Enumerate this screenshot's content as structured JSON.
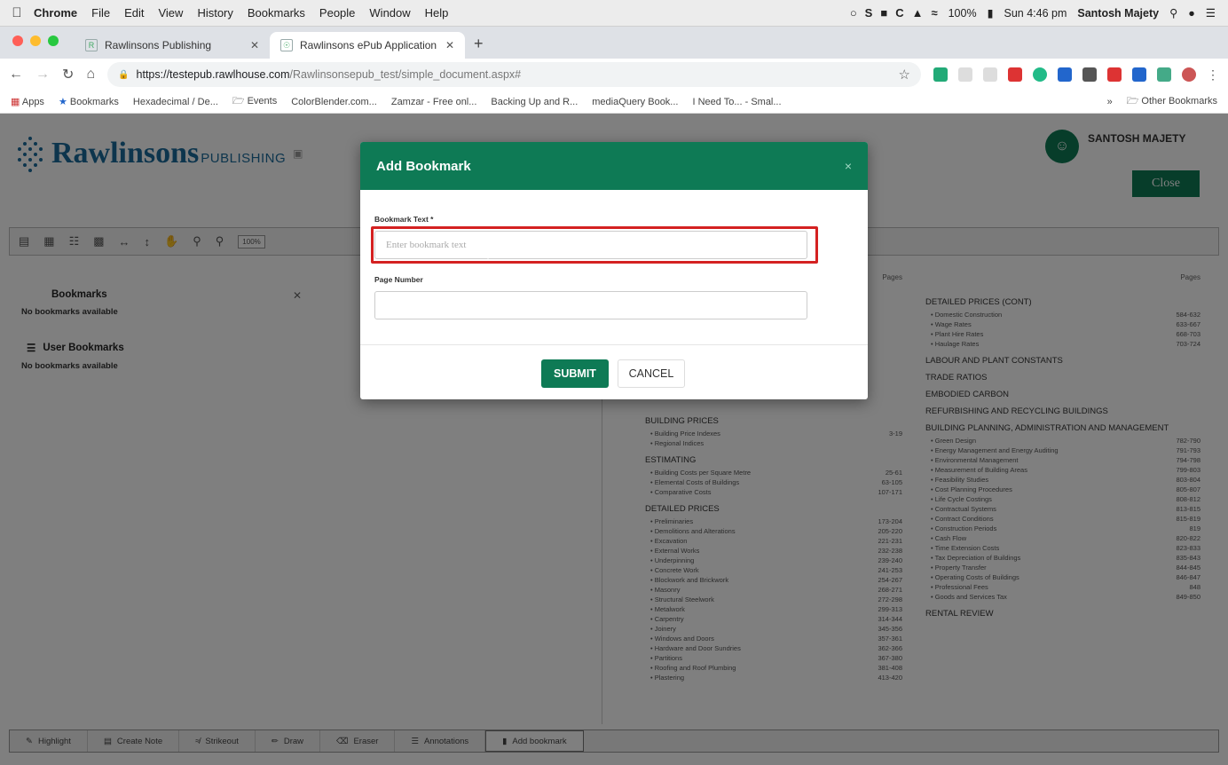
{
  "menubar": {
    "app": "Chrome",
    "items": [
      "File",
      "Edit",
      "View",
      "History",
      "Bookmarks",
      "People",
      "Window",
      "Help"
    ],
    "battery": "100%",
    "clock": "Sun 4:46 pm",
    "user": "Santosh Majety"
  },
  "tabs": [
    {
      "title": "Rawlinsons Publishing"
    },
    {
      "title": "Rawlinsons ePub Application"
    }
  ],
  "address": {
    "host": "https://testepub.rawlhouse.com",
    "path": "/Rawlinsonsepub_test/simple_document.aspx#"
  },
  "bookmarks_bar": [
    "Apps",
    "Bookmarks",
    "Hexadecimal / De...",
    "Events",
    "ColorBlender.com...",
    "Zamzar - Free onl...",
    "Backing Up and R...",
    "mediaQuery Book...",
    "I Need To... - Smal..."
  ],
  "bookmarks_bar_other": "Other Bookmarks",
  "app": {
    "brand": "Rawlinsons",
    "brand_sub": "PUBLISHING",
    "user_name": "SANTOSH MAJETY",
    "close_label": "Close",
    "zoom": "100%"
  },
  "sidebar": {
    "bookmarks_title": "Bookmarks",
    "bookmarks_empty": "No bookmarks available",
    "user_bookmarks_title": "User Bookmarks",
    "user_bookmarks_empty": "No bookmarks available"
  },
  "doc": {
    "pages_label": "Pages",
    "left_sections": [
      {
        "title": "Building Prices",
        "rows": [
          [
            "Building Price Indexes",
            "3-19"
          ],
          [
            "Regional Indices",
            ""
          ]
        ]
      },
      {
        "title": "Estimating",
        "rows": [
          [
            "Building Costs per Square Metre",
            "25-61"
          ],
          [
            "Elemental Costs of Buildings",
            "63-105"
          ],
          [
            "Comparative Costs",
            "107-171"
          ]
        ]
      },
      {
        "title": "Detailed Prices",
        "rows": [
          [
            "Preliminaries",
            "173-204"
          ],
          [
            "Demolitions and Alterations",
            "205-220"
          ],
          [
            "Excavation",
            "221-231"
          ],
          [
            "External Works",
            "232-238"
          ],
          [
            "Underpinning",
            "239-240"
          ],
          [
            "Concrete Work",
            "241-253"
          ],
          [
            "Blockwork and Brickwork",
            "254-267"
          ],
          [
            "Masonry",
            "268-271"
          ],
          [
            "Structural Steelwork",
            "272-298"
          ],
          [
            "Metalwork",
            "299-313"
          ],
          [
            "Carpentry",
            "314-344"
          ],
          [
            "Joinery",
            "345-356"
          ],
          [
            "Windows and Doors",
            "357-361"
          ],
          [
            "Hardware and Door Sundries",
            "362-366"
          ],
          [
            "Partitions",
            "367-380"
          ],
          [
            "Roofing and Roof Plumbing",
            "381-408"
          ],
          [
            "Plastering",
            "413-420"
          ]
        ]
      }
    ],
    "right_sections": [
      {
        "title": "Detailed Prices (cont)",
        "rows": [
          [
            "Domestic Construction",
            "584-632"
          ],
          [
            "Wage Rates",
            "633-667"
          ],
          [
            "Plant Hire Rates",
            "668-703"
          ],
          [
            "Haulage Rates",
            "703-724"
          ]
        ]
      },
      {
        "title": "Labour and Plant Constants",
        "rows": []
      },
      {
        "title": "Trade Ratios",
        "rows": []
      },
      {
        "title": "Embodied Carbon",
        "rows": []
      },
      {
        "title": "Refurbishing and Recycling Buildings",
        "rows": []
      },
      {
        "title": "Building Planning, Administration and Management",
        "rows": [
          [
            "Green Design",
            "782-790"
          ],
          [
            "Energy Management and Energy Auditing",
            "791-793"
          ],
          [
            "Environmental Management",
            "794-798"
          ],
          [
            "Measurement of Building Areas",
            "799-803"
          ],
          [
            "Feasibility Studies",
            "803-804"
          ],
          [
            "Cost Planning Procedures",
            "805-807"
          ],
          [
            "Life Cycle Costings",
            "808-812"
          ],
          [
            "Contractual Systems",
            "813-815"
          ],
          [
            "Contract Conditions",
            "815-819"
          ],
          [
            "Construction Periods",
            "819"
          ],
          [
            "Cash Flow",
            "820-822"
          ],
          [
            "Time Extension Costs",
            "823-833"
          ],
          [
            "Tax Depreciation of Buildings",
            "835-843"
          ],
          [
            "Property Transfer",
            "844-845"
          ],
          [
            "Operating Costs of Buildings",
            "846-847"
          ],
          [
            "Professional Fees",
            "848"
          ],
          [
            "Goods and Services Tax",
            "849-850"
          ]
        ]
      },
      {
        "title": "Rental Review",
        "rows": []
      }
    ]
  },
  "bottombar": [
    "Highlight",
    "Create Note",
    "Strikeout",
    "Draw",
    "Eraser",
    "Annotations",
    "Add bookmark"
  ],
  "modal": {
    "title": "Add Bookmark",
    "close": "×",
    "text_label": "Bookmark Text *",
    "text_placeholder": "Enter bookmark text",
    "page_label": "Page Number",
    "page_value": "",
    "submit": "SUBMIT",
    "cancel": "CANCEL"
  },
  "colors": {
    "accent": "#0e7a55",
    "highlight": "#d42121"
  }
}
